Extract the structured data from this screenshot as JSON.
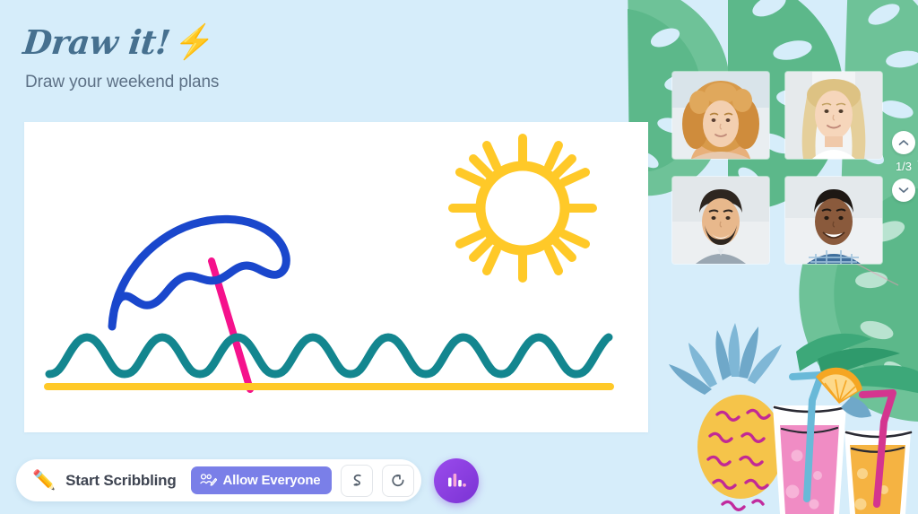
{
  "header": {
    "logo_text": "Draw it!",
    "logo_icon": "lightning-bolt-icon",
    "logo_bolt": "⚡",
    "subtitle": "Draw your weekend plans",
    "logo_color": "#46708f",
    "subtitle_color": "#5d7186"
  },
  "canvas": {
    "name": "drawing-canvas",
    "background": "#ffffff",
    "drawing_title": "beach scene",
    "elements": [
      {
        "name": "sun",
        "color": "#ffc928",
        "rays": 12
      },
      {
        "name": "beach-umbrella",
        "color": "#1a47cc"
      },
      {
        "name": "umbrella-pole",
        "color": "#f5128c"
      },
      {
        "name": "waves",
        "color": "#13868f"
      },
      {
        "name": "sand-line",
        "color": "#ffc928"
      }
    ]
  },
  "participants": {
    "label": "video-participants",
    "tiles": [
      {
        "name": "participant-tile-1",
        "alt": "woman with curly ginger hair"
      },
      {
        "name": "participant-tile-2",
        "alt": "woman with long blonde hair"
      },
      {
        "name": "participant-tile-3",
        "alt": "man with dark hair and beard"
      },
      {
        "name": "participant-tile-4",
        "alt": "smiling man in plaid shirt"
      }
    ]
  },
  "pagination": {
    "indicator": "1/3",
    "up_icon": "chevron-up-icon",
    "down_icon": "chevron-down-icon"
  },
  "toolbar": {
    "scribble_label": "Start Scribbling",
    "pencil_icon": "✏️",
    "allow_label": "Allow Everyone",
    "allow_icon": "people-edit-icon",
    "allow_color": "#7a7fe8",
    "undo_icon": "undo-icon",
    "redo_icon": "redo-icon",
    "stats_icon": "bar-chart-icon",
    "stats_color": "#8b3fe0"
  },
  "theme": {
    "background": "#d6edfa",
    "leaf_green": "#5cb88a",
    "pineapple_yellow": "#f5c44a",
    "drink_pink": "#f08cc4",
    "drink_orange": "#f5b342"
  }
}
